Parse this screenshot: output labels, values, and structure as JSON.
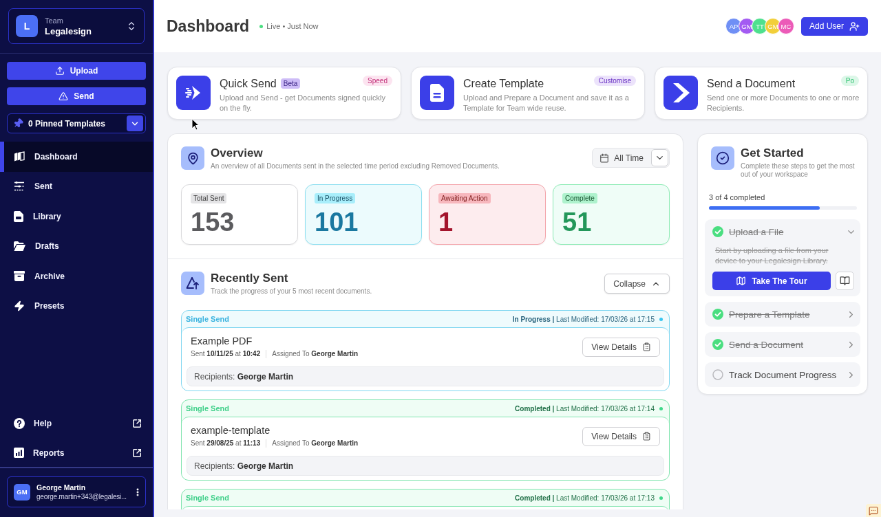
{
  "sidebar": {
    "team": {
      "avatar": "L",
      "label": "Team",
      "name": "Legalesign"
    },
    "actions": [
      {
        "label": "Upload"
      },
      {
        "label": "Send"
      }
    ],
    "pinned": {
      "label": "0 Pinned Templates"
    },
    "nav": [
      {
        "label": "Dashboard",
        "selected": true
      },
      {
        "label": "Sent",
        "selected": false
      },
      {
        "label": "Library",
        "selected": false
      },
      {
        "label": "Drafts",
        "selected": false
      },
      {
        "label": "Archive",
        "selected": false
      },
      {
        "label": "Presets",
        "selected": false
      }
    ],
    "links": [
      {
        "label": "Help"
      },
      {
        "label": "Reports"
      }
    ],
    "user": {
      "initials": "GM",
      "name": "George Martin",
      "email": "george.martin+343@legalesi..."
    }
  },
  "header": {
    "title": "Dashboard",
    "status": "Live • Just Now",
    "avatars": [
      {
        "initials": "AP",
        "color": "#6f8ff5"
      },
      {
        "initials": "GM",
        "color": "#a35bf2"
      },
      {
        "initials": "TT",
        "color": "#4ee08e"
      },
      {
        "initials": "GM",
        "color": "#f2cf3a"
      },
      {
        "initials": "MC",
        "color": "#ec5bb8"
      }
    ],
    "add_user": "Add User"
  },
  "quick_actions": [
    {
      "title": "Quick Send",
      "tag": "Beta",
      "badge": "Speed",
      "color": "#fce4f0",
      "description": "Upload and Send - get Documents signed quickly on the fly."
    },
    {
      "title": "Create Template",
      "badge": "Customise",
      "color": "#ece3fb",
      "description": "Upload and Prepare a Document and save it as a Template for Team wide reuse."
    },
    {
      "title": "Send a Document",
      "badge": "Po",
      "color": "#dcf7e8",
      "description": "Send one or more Documents to one or more Recipients."
    }
  ],
  "overview": {
    "title": "Overview",
    "subtitle": "An overview of all Documents sent in the selected time period excluding Removed Documents.",
    "range": "All Time",
    "stats": [
      {
        "kind": "total",
        "label": "Total Sent",
        "value": "153"
      },
      {
        "kind": "progress",
        "label": "In Progress",
        "value": "101"
      },
      {
        "kind": "awaiting",
        "label": "Awaiting Action",
        "value": "1"
      },
      {
        "kind": "complete",
        "label": "Complete",
        "value": "51"
      }
    ]
  },
  "recently_sent": {
    "title": "Recently Sent",
    "subtitle": "Track the progress of your 5 most recent documents.",
    "collapse": "Collapse",
    "documents": [
      {
        "kind": "in_progress",
        "type": "Single Send",
        "status": "**In Progress |** Last Modified: 17/03/26 at 17:15",
        "title": "Example PDF",
        "sent": "Sent **10/11/25** at **10:42**",
        "assigned": "Assigned To **George Martin**",
        "action": "View Details",
        "recipients": "Recipients: **George Martin**"
      },
      {
        "kind": "completed",
        "type": "Single Send",
        "status": "**Completed |** Last Modified: 17/03/26 at 17:14",
        "title": "example-template",
        "sent": "Sent **29/08/25** at **11:13**",
        "assigned": "Assigned To **George Martin**",
        "action": "View Details",
        "recipients": "Recipients: **George Martin**"
      },
      {
        "kind": "completed",
        "type": "Single Send",
        "status": "**Completed |** Last Modified: 17/03/26 at 17:13"
      }
    ]
  },
  "get_started": {
    "title": "Get Started",
    "subtitle": "Complete these steps to get the most out of your workspace",
    "progress": {
      "label": "3 of 4 completed",
      "level": 0.75
    },
    "steps": [
      {
        "title": "Upload a File",
        "done": true,
        "expanded": true,
        "description": "Start by uploading a file from your device to your Legalesign Library.",
        "action": "Take The Tour"
      },
      {
        "title": "Prepare a Template",
        "done": true,
        "expanded": false
      },
      {
        "title": "Send a Document",
        "done": true,
        "expanded": false
      },
      {
        "title": "Track Document Progress",
        "done": false,
        "expanded": false
      }
    ]
  }
}
